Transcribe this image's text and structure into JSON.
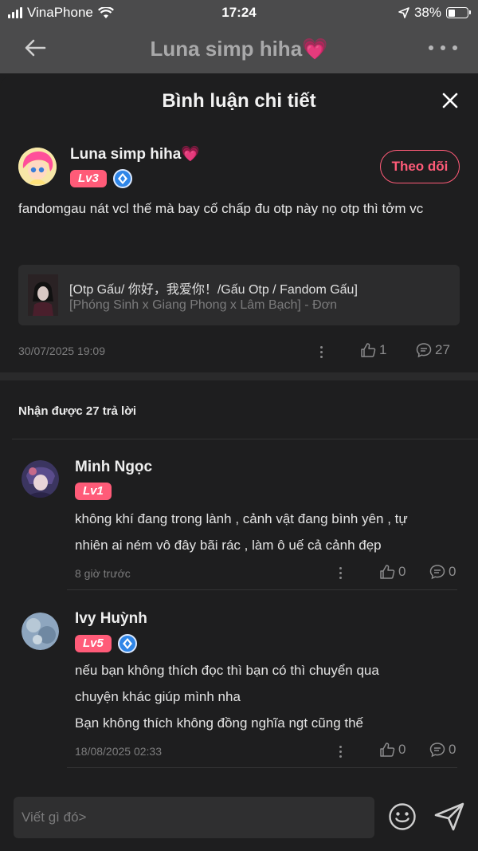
{
  "status_bar": {
    "carrier": "VinaPhone",
    "time": "17:24",
    "battery": "38%",
    "battery_level": 0.38
  },
  "behind_header": {
    "title": "Luna simp hiha💗"
  },
  "sheet": {
    "title": "Bình luận chi tiết"
  },
  "main_comment": {
    "author": "Luna simp hiha",
    "author_heart": "💗",
    "level": "Lv3",
    "follow_label": "Theo dõi",
    "text": "fandomgau nát vcl thế mà bay cố chấp đu otp này nọ otp thì tởm vc",
    "book": {
      "title": "[Otp Gấu/ 你好，我爱你！/Gấu Otp / Fandom Gấu]",
      "subtitle": "[Phóng Sinh x Giang Phong x Lâm Bạch] - Đơn"
    },
    "date": "30/07/2025 19:09",
    "likes": "1",
    "replies": "27"
  },
  "replies_header": "Nhận được 27 trả lời",
  "replies": [
    {
      "name": "Minh Ngọc",
      "level": "Lv1",
      "text_lines": [
        "không khí đang trong lành , cảnh vật đang bình yên , tự",
        "nhiên ai ném vô đây bãi rác , làm ô uế cả cảnh đẹp"
      ],
      "time": "8 giờ trước",
      "likes": "0",
      "comments": "0"
    },
    {
      "name": "Ivy Huỳnh",
      "level": "Lv5",
      "text_lines": [
        "nếu bạn không thích đọc thì bạn có thì chuyển qua",
        "chuyện khác giúp mình nha",
        "Bạn không thích không đồng nghĩa ngt cũng thế"
      ],
      "time": "18/08/2025 02:33",
      "likes": "0",
      "comments": "0"
    }
  ],
  "composer": {
    "placeholder": "Viết gì đó>"
  },
  "colors": {
    "accent": "#ff5b78",
    "background": "#1e1e1f",
    "verified": "#2f86e8"
  }
}
